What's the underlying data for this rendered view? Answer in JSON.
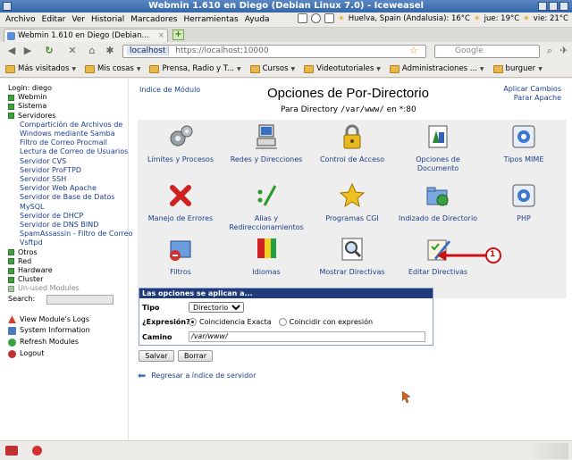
{
  "window": {
    "title": "Webmin 1.610 en Diego (Debian Linux 7.0) - Iceweasel"
  },
  "menubar": {
    "items": [
      "Archivo",
      "Editar",
      "Ver",
      "Historial",
      "Marcadores",
      "Herramientas",
      "Ayuda"
    ],
    "weather1": "Huelva, Spain (Andalusia): 16°C",
    "weather2": "jue: 19°C",
    "weather3": "vie: 21°C"
  },
  "tab": {
    "title": "Webmin 1.610 en Diego (Debian..."
  },
  "nav": {
    "host": "localhost",
    "url": "https://localhost:10000",
    "search_placeholder": "Google"
  },
  "bookmarks": [
    "Más visitados",
    "Mis cosas",
    "Prensa, Radio y T...",
    "Cursos",
    "Videotutoriales",
    "Administraciones ...",
    "burguer"
  ],
  "left": {
    "login": "Login: diego",
    "categories": [
      "Webmin",
      "Sistema",
      "Servidores"
    ],
    "servers": [
      "Compartición de Archivos de",
      "Windows mediante Samba",
      "Filtro de Correo Procmail",
      "Lectura de Correo de Usuarios",
      "Servidor CVS",
      "Servidor ProFTPD",
      "Servidor SSH",
      "Servidor Web Apache",
      "Servidor de Base de Datos",
      "MySQL",
      "Servidor de DHCP",
      "Servidor de DNS BIND",
      "SpamAssassin - Filtro de Correo",
      "Vsftpd"
    ],
    "more_categories": [
      "Otros",
      "Red",
      "Hardware",
      "Cluster"
    ],
    "unused": "Un-used Modules",
    "search_label": "Search:",
    "actions": [
      "View Module's Logs",
      "System Information",
      "Refresh Modules",
      "Logout"
    ]
  },
  "main": {
    "module_index": "Indice de Módulo",
    "apply_changes": "Aplicar Cambios",
    "stop_apache": "Parar Apache",
    "title": "Opciones de Por-Directorio",
    "subtitle_prefix": "Para Directory",
    "subtitle_path": "/var/www/",
    "subtitle_suffix": "en *:80",
    "icons": [
      "Límites y Procesos",
      "Redes y Direcciones",
      "Control de Acceso",
      "Opciones de Documento",
      "Tipos MIME",
      "Manejo de Errores",
      "Alias y Redireccionamientos",
      "Programas CGI",
      "Indizado de Directorio",
      "PHP",
      "Filtros",
      "Idiomas",
      "Mostrar Directivas",
      "Editar Directivas"
    ],
    "form": {
      "header": "Las opciones se aplican a...",
      "type_label": "Tipo",
      "type_value": "Directorio",
      "regex_label": "¿Expresión?",
      "radio_exact": "Coincidencia Exacta",
      "radio_regex": "Coincidir con expresión",
      "path_label": "Camino",
      "path_value": "/var/www/"
    },
    "save_button": "Salvar",
    "delete_button": "Borrar",
    "back_link": "Regresar a índice de servidor",
    "callout_number": "1"
  }
}
